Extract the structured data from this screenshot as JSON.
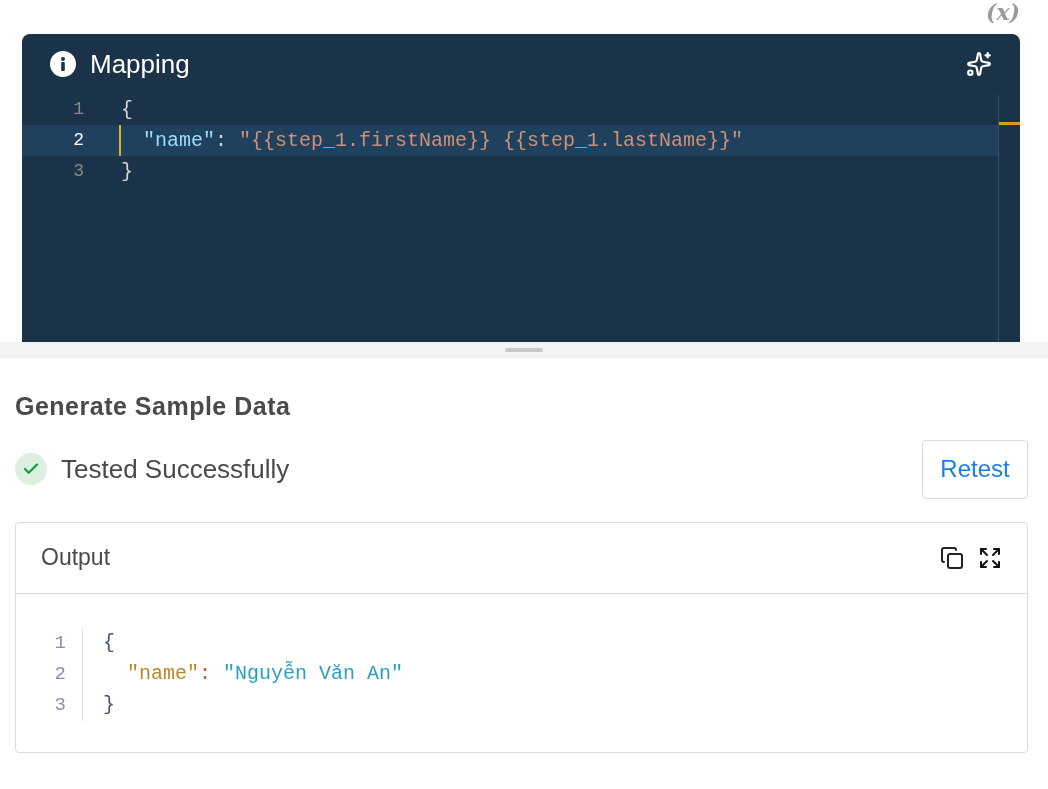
{
  "variables_toggle": {
    "label": "(x)"
  },
  "mapping": {
    "title": "Mapping",
    "lines": [
      {
        "number": "1",
        "kind": "brace",
        "selected": false,
        "tokens": [
          {
            "kind": "brace",
            "text": "{"
          }
        ]
      },
      {
        "number": "2",
        "kind": "member",
        "selected": true,
        "tokens": [
          {
            "kind": "key",
            "text": "\"name\""
          },
          {
            "kind": "colon",
            "text": ":"
          },
          {
            "kind": "string",
            "text": "\"{{step_1.firstName}} {{step_1.lastName}}\""
          }
        ]
      },
      {
        "number": "3",
        "kind": "brace",
        "selected": false,
        "tokens": [
          {
            "kind": "brace",
            "text": "}"
          }
        ]
      }
    ]
  },
  "sample": {
    "title": "Generate Sample Data",
    "status": {
      "text": "Tested Successfully",
      "success": true
    },
    "retest_button": "Retest",
    "output": {
      "title": "Output",
      "lines": [
        {
          "number": "1",
          "kind": "brace",
          "tokens": [
            {
              "kind": "brace",
              "text": "{"
            }
          ]
        },
        {
          "number": "2",
          "kind": "member",
          "tokens": [
            {
              "kind": "key",
              "text": "\"name\""
            },
            {
              "kind": "colon",
              "text": ":"
            },
            {
              "kind": "string",
              "text": "\"Nguyễn Văn An\""
            }
          ]
        },
        {
          "number": "3",
          "kind": "brace",
          "tokens": [
            {
              "kind": "brace",
              "text": "}"
            }
          ]
        }
      ]
    }
  }
}
